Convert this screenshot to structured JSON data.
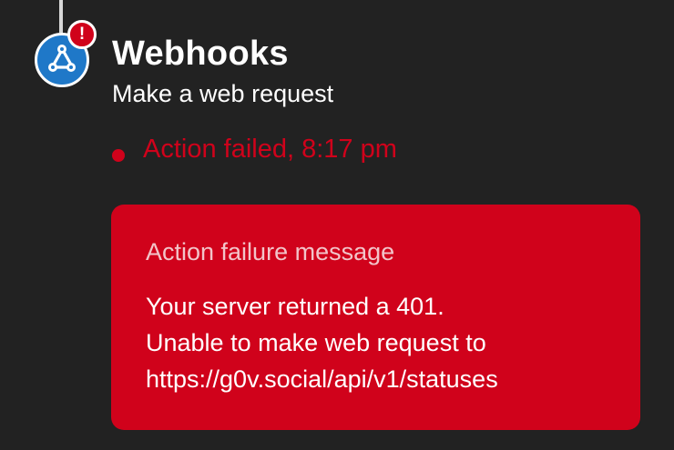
{
  "applet": {
    "service_name": "Webhooks",
    "action_name": "Make a web request",
    "error_badge": "!",
    "service_icon": "webhooks-icon",
    "accent_color": "#1f78c8"
  },
  "status": {
    "text": "Action failed, 8:17 pm",
    "color": "#d0021b"
  },
  "failure": {
    "title": "Action failure message",
    "lines": [
      "Your server returned a 401.",
      "Unable to make web request to",
      "https://g0v.social/api/v1/statuses"
    ],
    "background": "#d0021b"
  }
}
